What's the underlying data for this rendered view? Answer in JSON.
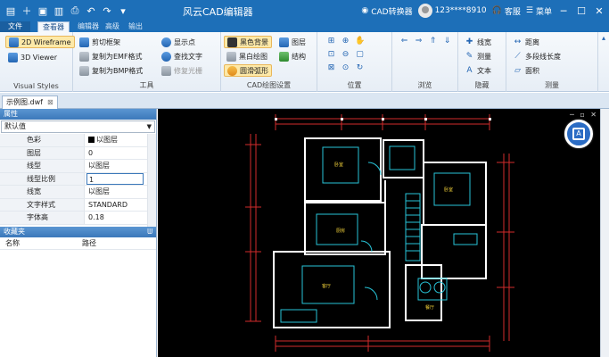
{
  "titlebar": {
    "title": "风云CAD编辑器",
    "converter_label": "CAD转换器",
    "user_label": "123****8910",
    "service_label": "客服",
    "menu_label": "菜单",
    "colors": {
      "bar": "#1d6fb8"
    }
  },
  "tabs": {
    "file": "文件",
    "viewer": "查看器",
    "editor": "编辑器",
    "advanced": "高级",
    "output": "输出"
  },
  "ribbon": {
    "visual_styles": {
      "wireframe_2d": "2D Wireframe",
      "viewer_3d": "3D Viewer",
      "label": "Visual Styles"
    },
    "tools": {
      "clip_frame": "剪切框架",
      "copy_emf": "复制为EMF格式",
      "copy_bmp": "复制为BMP格式",
      "show_points": "显示点",
      "find_text": "查找文字",
      "fix_raster": "修复光栅",
      "label": "工具"
    },
    "cad_settings": {
      "black_bg": "黑色背景",
      "bw_draw": "黑白绘图",
      "smooth_arc": "圆滑弧形",
      "layers": "图层",
      "structure": "结构",
      "label": "CAD绘图设置"
    },
    "position": {
      "label": "位置"
    },
    "browse": {
      "label": "浏览"
    },
    "hide": {
      "linear": "线宽",
      "measure": "测量",
      "text": "文本",
      "label": "隐藏"
    },
    "measure": {
      "distance": "距离",
      "polyline_length": "多段线长度",
      "area": "面积",
      "label": "测量"
    }
  },
  "document": {
    "tab_name": "示例图.dwf"
  },
  "properties": {
    "title": "属性",
    "combo_value": "默认值",
    "rows": [
      {
        "key": "色彩",
        "value": "以图层",
        "swatch": true
      },
      {
        "key": "图层",
        "value": "0"
      },
      {
        "key": "线型",
        "value": "以图层"
      },
      {
        "key": "线型比例",
        "value": "1",
        "edit": true
      },
      {
        "key": "线宽",
        "value": "以图层"
      },
      {
        "key": "文字样式",
        "value": "STANDARD"
      },
      {
        "key": "字体高",
        "value": "0.18"
      }
    ]
  },
  "favorites": {
    "title": "收藏夹",
    "col_name": "名称",
    "col_path": "路径"
  },
  "plan": {
    "room_labels": [
      "卧室",
      "卧室",
      "客厅",
      "厨房",
      "餐厅"
    ],
    "colors": {
      "wall": "#ffffff",
      "dim": "#d22b2b",
      "furn": "#27c4d8",
      "text": "#f2d13a"
    }
  }
}
